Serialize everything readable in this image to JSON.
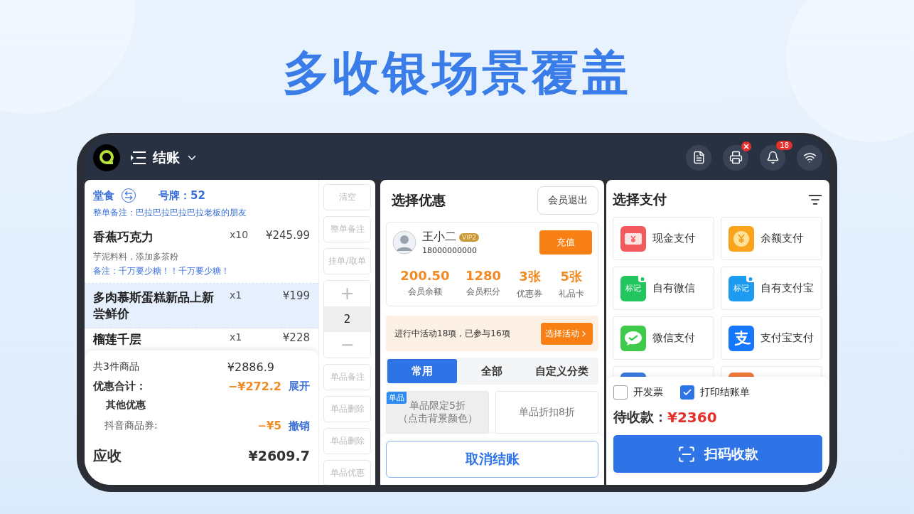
{
  "headline": "多收银场景覆盖",
  "header": {
    "title": "结账",
    "icons": [
      {
        "kind": "document"
      },
      {
        "kind": "printer",
        "alert": true
      },
      {
        "kind": "bell",
        "count": "18"
      },
      {
        "kind": "wifi"
      }
    ]
  },
  "order": {
    "mode": "堂食",
    "ticket": "号牌：52",
    "note": "整单备注：巴拉巴拉巴拉巴拉老板的朋友",
    "items": [
      {
        "name": "香蕉巧克力",
        "qty": "x10",
        "price": "¥245.99",
        "options": "芋泥料料，添加多茶粉",
        "remark": "备注：千万要少糖！！千万要少糖！",
        "selected": false
      },
      {
        "name": "多肉慕斯蛋糕新品上新尝鲜价",
        "qty": "x1",
        "price": "¥199",
        "selected": true
      },
      {
        "name": "榴莲千层",
        "qty": "x1",
        "price": "¥228",
        "selected": false
      }
    ],
    "summary": {
      "count_label": "共3件商品",
      "subtotal": "¥2886.9",
      "discount_label": "优惠合计：",
      "discount": "−¥272.2",
      "expand": "展开",
      "other_label": "其他优惠",
      "coupon_label": "抖音商品券:",
      "coupon": "−¥5",
      "revoke": "撤销",
      "due_label": "应收",
      "due": "¥2609.7"
    }
  },
  "actions": [
    "清空",
    "整单备注",
    "挂单/取单"
  ],
  "stepper": {
    "plus": "+",
    "value": "2",
    "minus": "−"
  },
  "item_actions": [
    "单品备注",
    "单品删除",
    "单品删除",
    "单品优惠"
  ],
  "discount": {
    "title": "选择优惠",
    "logout": "会员退出",
    "member": {
      "name": "王小二",
      "vip": "VIP2",
      "phone": "18000000000",
      "recharge": "充值",
      "stats": [
        {
          "value": "200.50",
          "label": "会员余额"
        },
        {
          "value": "1280",
          "label": "会员积分"
        },
        {
          "value": "3张",
          "label": "优惠券"
        },
        {
          "value": "5张",
          "label": "礼品卡"
        }
      ]
    },
    "activity": {
      "text": "进行中活动18项，已参与16项",
      "button": "选择活动"
    },
    "tabs": [
      {
        "label": "常用",
        "selected": true
      },
      {
        "label": "全部",
        "selected": false
      },
      {
        "label": "自定义分类",
        "selected": false
      }
    ],
    "offers": [
      {
        "tag": "单品",
        "label": "单品限定5折",
        "hint": "（点击背景颜色）",
        "selected": true
      },
      {
        "label": "单品折扣8折",
        "selected": false
      }
    ],
    "cancel": "取消结账"
  },
  "payment": {
    "title": "选择支付",
    "methods": [
      {
        "kind": "cash",
        "label": "现金支付",
        "color": "#f25a5e"
      },
      {
        "kind": "balance",
        "label": "余额支付",
        "color": "#fba31c"
      },
      {
        "kind": "tagged",
        "label": "自有微信",
        "badge_text": "标记",
        "color": "#22c55e"
      },
      {
        "kind": "tagged",
        "label": "自有支付宝",
        "badge_text": "标记",
        "color": "#1d9bf0"
      },
      {
        "kind": "wechat",
        "label": "微信支付",
        "color": "#3fca4a"
      },
      {
        "kind": "alipay",
        "label": "支付宝支付",
        "color": "#1677ff"
      },
      {
        "kind": "partial",
        "color": "#3b7be0"
      },
      {
        "kind": "partial",
        "color": "#f07a3a"
      }
    ],
    "options": [
      {
        "label": "开发票",
        "checked": false
      },
      {
        "label": "打印结账单",
        "checked": true
      }
    ],
    "pending_label": "待收款：",
    "pending": "¥2360",
    "scan": "扫码收款"
  }
}
